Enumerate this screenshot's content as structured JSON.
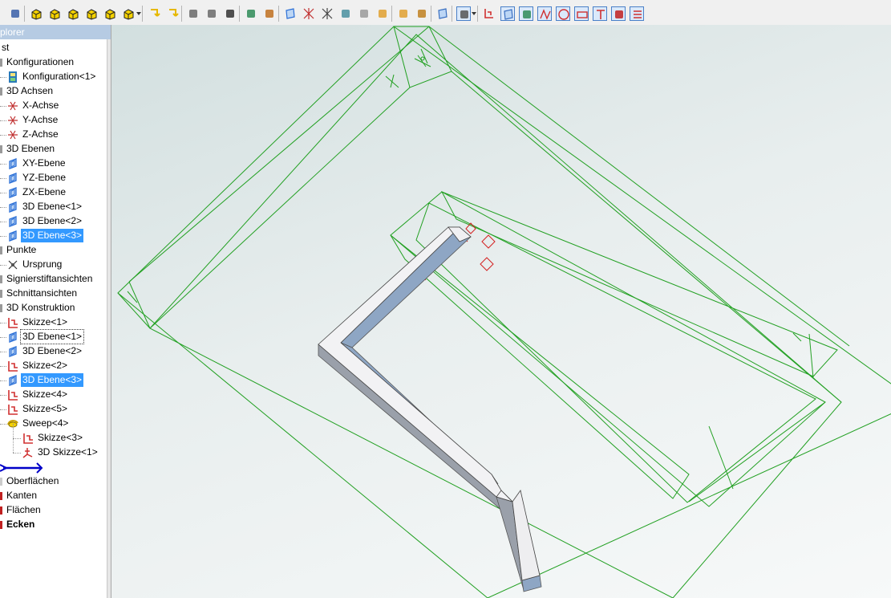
{
  "toolbar": {
    "icons": [
      "logo-icon",
      "cube-yellow-icon",
      "cube-yellow-icon",
      "cube-yellow-icon",
      "cube-yellow-icon",
      "cube-yellow-icon",
      "cube-yellow-icon",
      "arrow-down-left-icon",
      "arrow-down-right-icon",
      "grid-icon",
      "dots-icon",
      "eye-icon",
      "refresh-icon",
      "flask-icon",
      "plane-icon",
      "axis-icon",
      "origin-icon",
      "transform-icon",
      "cylinder-icon",
      "jar-icon",
      "ruler-icon",
      "balance-icon",
      "sketch-select-icon",
      "solid-icon",
      "sketch-icon",
      "ref-icons",
      "constraint-icon",
      "line-icon",
      "circle-icon",
      "rectangle-icon",
      "text-icon",
      "red-cube-icon",
      "menu-icon"
    ],
    "accent_color": "#4a80c8"
  },
  "explorer": {
    "title": "plorer",
    "tree": [
      {
        "label": "st",
        "icon": "",
        "depth": 0
      },
      {
        "label": "Konfigurationen",
        "icon": "",
        "depth": 1
      },
      {
        "label": "Konfiguration<1>",
        "icon": "config-icon",
        "depth": 2
      },
      {
        "label": "3D Achsen",
        "icon": "",
        "depth": 1
      },
      {
        "label": "X-Achse",
        "icon": "axis-icon",
        "depth": 2
      },
      {
        "label": "Y-Achse",
        "icon": "axis-icon",
        "depth": 2
      },
      {
        "label": "Z-Achse",
        "icon": "axis-icon",
        "depth": 2
      },
      {
        "label": "3D Ebenen",
        "icon": "",
        "depth": 1
      },
      {
        "label": "XY-Ebene",
        "icon": "plane-icon",
        "depth": 2
      },
      {
        "label": "YZ-Ebene",
        "icon": "plane-icon",
        "depth": 2
      },
      {
        "label": "ZX-Ebene",
        "icon": "plane-icon",
        "depth": 2
      },
      {
        "label": "3D Ebene<1>",
        "icon": "plane-icon",
        "depth": 2
      },
      {
        "label": "3D Ebene<2>",
        "icon": "plane-icon",
        "depth": 2
      },
      {
        "label": "3D Ebene<3>",
        "icon": "plane-icon",
        "depth": 2,
        "selected": true
      },
      {
        "label": "Punkte",
        "icon": "",
        "depth": 1
      },
      {
        "label": "Ursprung",
        "icon": "origin-icon",
        "depth": 2
      },
      {
        "label": "Signierstiftansichten",
        "icon": "",
        "depth": 1
      },
      {
        "label": "Schnittansichten",
        "icon": "",
        "depth": 1
      },
      {
        "label": "3D Konstruktion",
        "icon": "",
        "depth": 1
      },
      {
        "label": "Skizze<1>",
        "icon": "sketch-icon",
        "depth": 2
      },
      {
        "label": "3D Ebene<1>",
        "icon": "plane-icon",
        "depth": 2,
        "focused": true
      },
      {
        "label": "3D Ebene<2>",
        "icon": "plane-icon",
        "depth": 2
      },
      {
        "label": "Skizze<2>",
        "icon": "sketch-icon",
        "depth": 2
      },
      {
        "label": "3D Ebene<3>",
        "icon": "plane-icon",
        "depth": 2,
        "selected": true
      },
      {
        "label": "Skizze<4>",
        "icon": "sketch-icon",
        "depth": 2
      },
      {
        "label": "Skizze<5>",
        "icon": "sketch-icon",
        "depth": 2
      },
      {
        "label": "Sweep<4>",
        "icon": "sweep-icon",
        "depth": 2
      },
      {
        "label": "Skizze<3>",
        "icon": "sketch-icon",
        "depth": 3
      },
      {
        "label": "3D Skizze<1>",
        "icon": "sketch3d-icon",
        "depth": 3
      },
      {
        "label": "",
        "icon": "rollback-bar-icon",
        "depth": 0
      },
      {
        "label": "Oberflächen",
        "icon": "",
        "depth": 1
      },
      {
        "label": "Kanten",
        "icon": "",
        "depth": 1
      },
      {
        "label": "Flächen",
        "icon": "",
        "depth": 1
      },
      {
        "label": "Ecken",
        "icon": "",
        "depth": 1,
        "bold": true
      }
    ]
  },
  "viewport": {
    "plane_color": "#22a022",
    "sketch_color": "#d42020",
    "solid_top_color": "#f2f2f4",
    "solid_side_color": "#8ea6c4"
  }
}
